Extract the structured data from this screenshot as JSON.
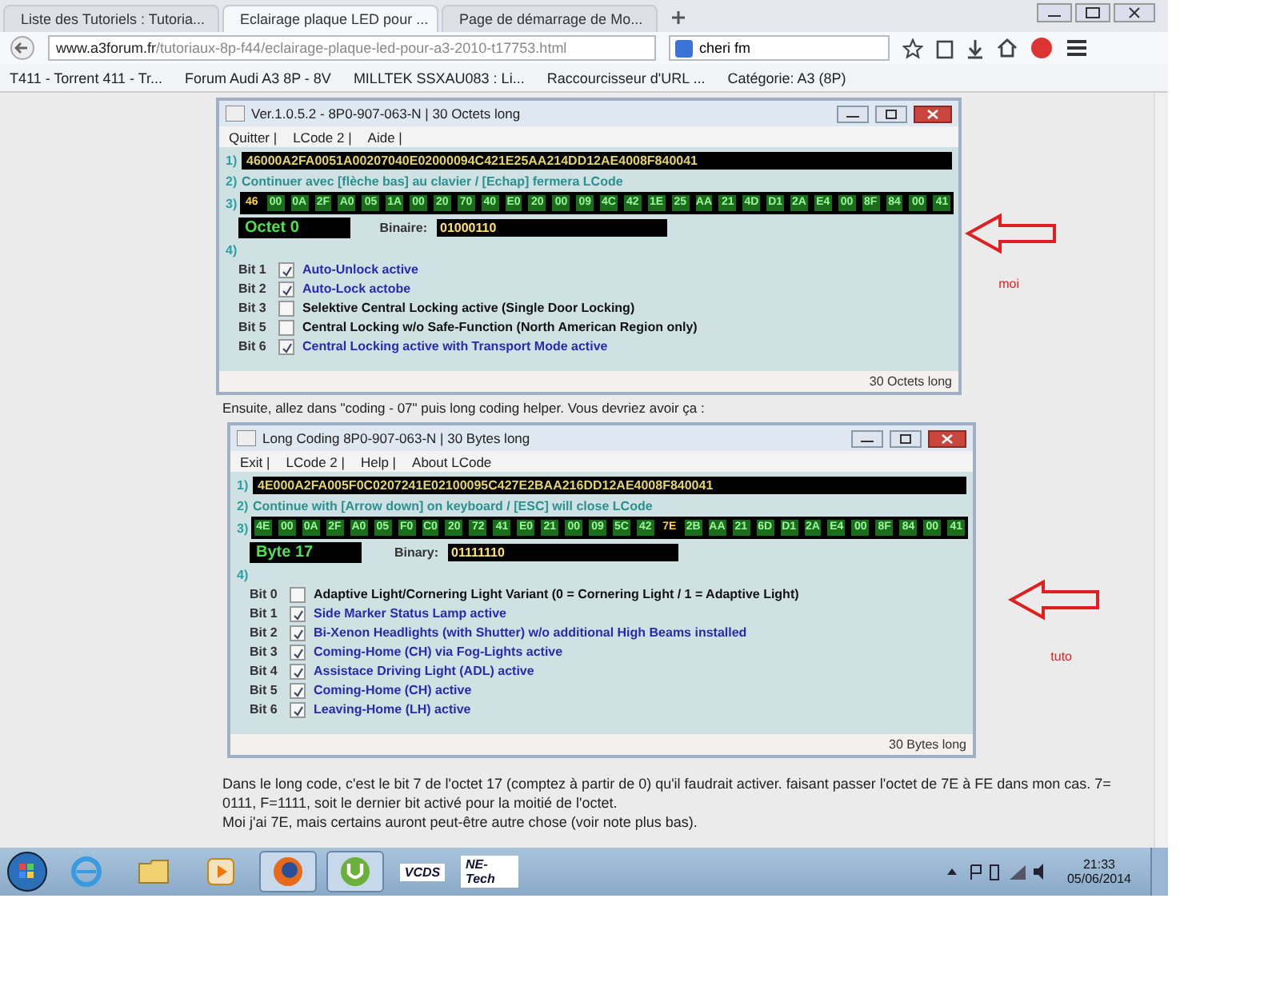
{
  "browser": {
    "tabs": [
      {
        "title": "Liste des Tutoriels : Tutoria...",
        "selected": false
      },
      {
        "title": "Eclairage plaque LED pour ...",
        "selected": true
      },
      {
        "title": "Page de démarrage de Mo...",
        "selected": false
      }
    ],
    "url_host": "www.a3forum.fr",
    "url_path": "/tutoriaux-8p-f44/eclairage-plaque-led-pour-a3-2010-t17753.html",
    "search": {
      "value": "cheri fm"
    },
    "bookmarks": [
      "T411 - Torrent 411 - Tr...",
      "Forum Audi A3 8P - 8V",
      "MILLTEK SSXAU083 : Li...",
      "Raccourcisseur d'URL ...",
      "Catégorie: A3 (8P)"
    ]
  },
  "windows": [
    {
      "title": "Ver.1.0.5.2 -  8P0-907-063-N | 30 Octets long",
      "menu": [
        "Quitter |",
        "LCode 2 |",
        "Aide |"
      ],
      "steps": [
        "1)",
        "2)",
        "3)",
        "4)"
      ],
      "code": "46000A2FA0051A00207040E02000094C421E25AA214DD12AE4008F840041",
      "hint": "Continuer avec [flèche bas] au clavier / [Echap] fermera LCode",
      "bytes": [
        {
          "value": "46",
          "selected": true
        },
        {
          "value": "00",
          "selected": false
        },
        {
          "value": "0A",
          "selected": false
        },
        {
          "value": "2F",
          "selected": false
        },
        {
          "value": "A0",
          "selected": false
        },
        {
          "value": "05",
          "selected": false
        },
        {
          "value": "1A",
          "selected": false
        },
        {
          "value": "00",
          "selected": false
        },
        {
          "value": "20",
          "selected": false
        },
        {
          "value": "70",
          "selected": false
        },
        {
          "value": "40",
          "selected": false
        },
        {
          "value": "E0",
          "selected": false
        },
        {
          "value": "20",
          "selected": false
        },
        {
          "value": "00",
          "selected": false
        },
        {
          "value": "09",
          "selected": false
        },
        {
          "value": "4C",
          "selected": false
        },
        {
          "value": "42",
          "selected": false
        },
        {
          "value": "1E",
          "selected": false
        },
        {
          "value": "25",
          "selected": false
        },
        {
          "value": "AA",
          "selected": false
        },
        {
          "value": "21",
          "selected": false
        },
        {
          "value": "4D",
          "selected": false
        },
        {
          "value": "D1",
          "selected": false
        },
        {
          "value": "2A",
          "selected": false
        },
        {
          "value": "E4",
          "selected": false
        },
        {
          "value": "00",
          "selected": false
        },
        {
          "value": "8F",
          "selected": false
        },
        {
          "value": "84",
          "selected": false
        },
        {
          "value": "00",
          "selected": false
        },
        {
          "value": "41",
          "selected": false
        }
      ],
      "byte_label": "Octet 0",
      "binary_label": "Binaire:",
      "binary_value": "01000110",
      "bits": [
        {
          "label": "Bit 1",
          "text": "Auto-Unlock active",
          "checked": true
        },
        {
          "label": "Bit 2",
          "text": "Auto-Lock actobe",
          "checked": true
        },
        {
          "label": "Bit 3",
          "text": "Selektive Central Locking active (Single Door Locking)",
          "checked": false
        },
        {
          "label": "Bit 5",
          "text": "Central Locking w/o Safe-Function (North American Region only)",
          "checked": false
        },
        {
          "label": "Bit 6",
          "text": "Central Locking active with Transport Mode active",
          "checked": true
        }
      ],
      "status": "30 Octets long",
      "note": "moi"
    },
    {
      "title": "Long Coding  8P0-907-063-N | 30 Bytes long",
      "menu": [
        "Exit |",
        "LCode 2 |",
        "Help |",
        "About LCode"
      ],
      "steps": [
        "1)",
        "2)",
        "3)",
        "4)"
      ],
      "code": "4E000A2FA005F0C0207241E02100095C427E2BAA216DD12AE4008F840041",
      "hint": "Continue with [Arrow down] on keyboard / [ESC] will close LCode",
      "bytes": [
        {
          "value": "4E",
          "selected": false
        },
        {
          "value": "00",
          "selected": false
        },
        {
          "value": "0A",
          "selected": false
        },
        {
          "value": "2F",
          "selected": false
        },
        {
          "value": "A0",
          "selected": false
        },
        {
          "value": "05",
          "selected": false
        },
        {
          "value": "F0",
          "selected": false
        },
        {
          "value": "C0",
          "selected": false
        },
        {
          "value": "20",
          "selected": false
        },
        {
          "value": "72",
          "selected": false
        },
        {
          "value": "41",
          "selected": false
        },
        {
          "value": "E0",
          "selected": false
        },
        {
          "value": "21",
          "selected": false
        },
        {
          "value": "00",
          "selected": false
        },
        {
          "value": "09",
          "selected": false
        },
        {
          "value": "5C",
          "selected": false
        },
        {
          "value": "42",
          "selected": false
        },
        {
          "value": "7E",
          "selected": true
        },
        {
          "value": "2B",
          "selected": false
        },
        {
          "value": "AA",
          "selected": false
        },
        {
          "value": "21",
          "selected": false
        },
        {
          "value": "6D",
          "selected": false
        },
        {
          "value": "D1",
          "selected": false
        },
        {
          "value": "2A",
          "selected": false
        },
        {
          "value": "E4",
          "selected": false
        },
        {
          "value": "00",
          "selected": false
        },
        {
          "value": "8F",
          "selected": false
        },
        {
          "value": "84",
          "selected": false
        },
        {
          "value": "00",
          "selected": false
        },
        {
          "value": "41",
          "selected": false
        }
      ],
      "byte_label": "Byte 17",
      "binary_label": "Binary:",
      "binary_value": "01111110",
      "bits": [
        {
          "label": "Bit 0",
          "text": "Adaptive Light/Cornering Light Variant (0 = Cornering Light / 1 = Adaptive Light)",
          "checked": false
        },
        {
          "label": "Bit 1",
          "text": "Side Marker Status Lamp active",
          "checked": true
        },
        {
          "label": "Bit 2",
          "text": "Bi-Xenon Headlights (with Shutter) w/o additional High Beams installed",
          "checked": true
        },
        {
          "label": "Bit 3",
          "text": "Coming-Home (CH) via Fog-Lights active",
          "checked": true
        },
        {
          "label": "Bit 4",
          "text": "Assistace Driving Light (ADL) active",
          "checked": true
        },
        {
          "label": "Bit 5",
          "text": "Coming-Home (CH) active",
          "checked": true
        },
        {
          "label": "Bit 6",
          "text": "Leaving-Home (LH) active",
          "checked": true
        }
      ],
      "status": "30 Bytes long",
      "note": "tuto"
    }
  ],
  "article": {
    "intro": "Ensuite, allez dans \"coding - 07\" puis long coding helper. Vous devriez avoir ça :",
    "paragraphs": [
      "Dans le long code, c'est le bit 7 de l'octet 17 (comptez à partir de 0) qu'il faudrait activer. faisant passer l'octet de 7E à FE dans mon cas. 7= 0111, F=1111, soit le dernier bit activé pour la moitié de l'octet.",
      "Moi j'ai 7E, mais certains auront peut-être autre chose (voir note plus bas)."
    ]
  },
  "taskbar": {
    "apps": [
      {
        "kind": "ie"
      },
      {
        "kind": "folder"
      },
      {
        "kind": "media"
      },
      {
        "kind": "firefox",
        "selected": true
      },
      {
        "kind": "torrent",
        "selected": true
      },
      {
        "kind": "label",
        "text": "VCDS"
      },
      {
        "kind": "label",
        "text": "NE-Tech"
      }
    ],
    "time": "21:33",
    "date": "05/06/2014"
  }
}
